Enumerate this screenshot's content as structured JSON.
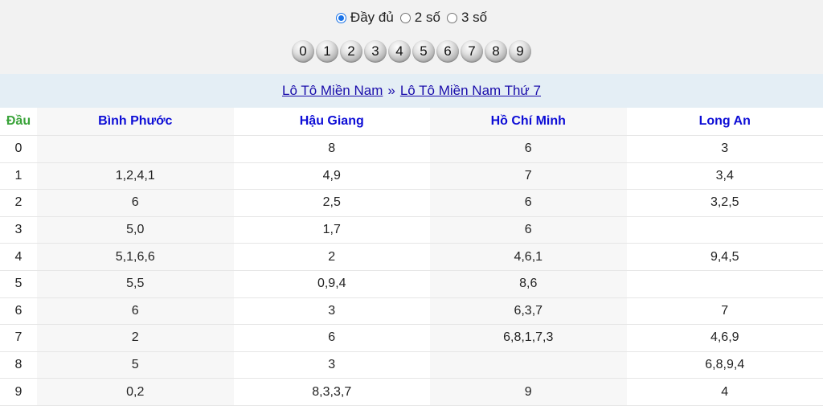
{
  "options": {
    "items": [
      {
        "label": "Đầy đủ",
        "checked": true
      },
      {
        "label": "2 số",
        "checked": false
      },
      {
        "label": "3 số",
        "checked": false
      }
    ]
  },
  "digits": [
    "0",
    "1",
    "2",
    "3",
    "4",
    "5",
    "6",
    "7",
    "8",
    "9"
  ],
  "breadcrumb": {
    "parent": "Lô Tô Miền Nam",
    "separator": "»",
    "current": "Lô Tô Miền Nam Thứ 7"
  },
  "table": {
    "headers": [
      "Đầu",
      "Bình Phước",
      "Hậu Giang",
      "Hồ Chí Minh",
      "Long An"
    ],
    "rows": [
      [
        "0",
        "",
        "8",
        "6",
        "3"
      ],
      [
        "1",
        "1,2,4,1",
        "4,9",
        "7",
        "3,4"
      ],
      [
        "2",
        "6",
        "2,5",
        "6",
        "3,2,5"
      ],
      [
        "3",
        "5,0",
        "1,7",
        "6",
        ""
      ],
      [
        "4",
        "5,1,6,6",
        "2",
        "4,6,1",
        "9,4,5"
      ],
      [
        "5",
        "5,5",
        "0,9,4",
        "8,6",
        ""
      ],
      [
        "6",
        "6",
        "3",
        "6,3,7",
        "7"
      ],
      [
        "7",
        "2",
        "6",
        "6,8,1,7,3",
        "4,6,9"
      ],
      [
        "8",
        "5",
        "3",
        "",
        "6,8,9,4"
      ],
      [
        "9",
        "0,2",
        "8,3,3,7",
        "9",
        "4"
      ]
    ]
  },
  "colors": {
    "header_text": "#0d0dd6",
    "dau_header": "#3aa33a",
    "link": "#1a0dab",
    "radio_accent": "#1a73e8"
  }
}
